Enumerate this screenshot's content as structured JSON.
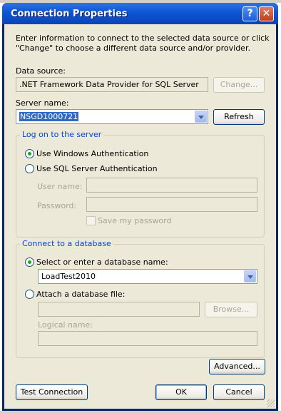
{
  "window": {
    "title": "Connection Properties"
  },
  "intro_text_line1": "Enter information to connect to the selected data source or click",
  "intro_text_line2": "\"Change\" to choose a different data source and/or provider.",
  "data_source": {
    "label": "Data source:",
    "value": ".NET Framework Data Provider for SQL Server",
    "change_label": "Change..."
  },
  "server": {
    "label": "Server name:",
    "value": "NSGD1000721",
    "refresh_label": "Refresh"
  },
  "logon": {
    "title": "Log on to the server",
    "windows_auth": "Use Windows Authentication",
    "sql_auth": "Use SQL Server Authentication",
    "user_name_label": "User name:",
    "password_label": "Password:",
    "save_password_label": "Save my password",
    "selected": "windows"
  },
  "database": {
    "title": "Connect to a database",
    "select_label": "Select or enter a database name:",
    "selected_db": "LoadTest2010",
    "attach_label": "Attach a database file:",
    "browse_label": "Browse...",
    "logical_name_label": "Logical name:",
    "selected": "select"
  },
  "buttons": {
    "advanced": "Advanced...",
    "test": "Test Connection",
    "ok": "OK",
    "cancel": "Cancel"
  }
}
